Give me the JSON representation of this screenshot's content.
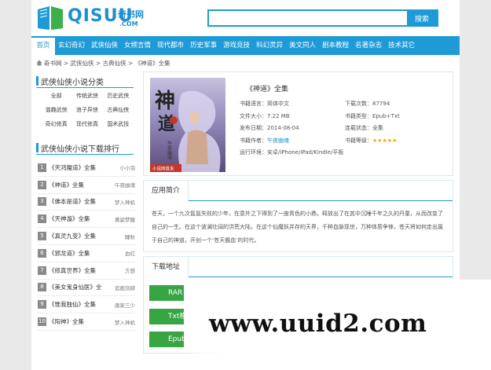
{
  "header": {
    "brand": "QISUU",
    "brand_cn": "奇书网",
    "brand_com": ".COM",
    "search_placeholder": "",
    "search_button": "搜索"
  },
  "nav": [
    "首页",
    "玄幻奇幻",
    "武侠仙侠",
    "女频言情",
    "现代都市",
    "历史军事",
    "游戏竞技",
    "科幻灵异",
    "美文同人",
    "剧本教程",
    "名著杂志",
    "技术其它"
  ],
  "breadcrumb": "奇书网 > 武侠仙侠 > 古典仙侠 > 《神道》全集",
  "sidebar": {
    "categories_title": "武侠仙侠小说分类",
    "categories": [
      "全部",
      "传统武侠",
      "历史武侠",
      "谐趣武侠",
      "浪子异侠",
      "古典仙侠",
      "奇幻修真",
      "现代修真",
      "国术武技"
    ],
    "ranking_title": "武侠仙侠小说下载排行",
    "ranking": [
      {
        "num": "1",
        "title": "《天鸿魔道》全集",
        "author": "小小羽"
      },
      {
        "num": "2",
        "title": "《神道》全集",
        "author": "午夜幽魂"
      },
      {
        "num": "3",
        "title": "《佛本是道》全集",
        "author": "梦入神机"
      },
      {
        "num": "4",
        "title": "《天神漩》全集",
        "author": "黄粱梦醒"
      },
      {
        "num": "5",
        "title": "《真灵九变》全集",
        "author": "睡秋"
      },
      {
        "num": "6",
        "title": "《邪龙道》全集",
        "author": "血红"
      },
      {
        "num": "7",
        "title": "《修真世界》全集",
        "author": "方想"
      },
      {
        "num": "8",
        "title": "《美女鬼身仙医》全",
        "author": "追画剑肆"
      },
      {
        "num": "9",
        "title": "《惟我独仙》全集",
        "author": "唐家三少"
      },
      {
        "num": "10",
        "title": "《阳神》全集",
        "author": "梦入神机"
      }
    ]
  },
  "book": {
    "title": "《神道》全集",
    "language": "书籍语言：简体中文",
    "downloads": "下载次数：87794",
    "size": "文件大小：7.22 MB",
    "type": "书籍类型：Epub+Txt",
    "date": "发布日期：2014-08-04",
    "status": "连载状态：全集",
    "author_label": "书籍作者：",
    "author": "午夜幽魂",
    "rating_label": "书籍等级：",
    "rating": 5,
    "stars": "★★★★★",
    "env": "运行环境：安卓/iPhone/iPad/Kindle/平板",
    "cover_title": "神道",
    "cover_author": "午夜幽魂",
    "cover_badge": "小说网首发"
  },
  "intro": {
    "heading": "应用简介",
    "text": "苍天，一个九次氤氲失败的少年，在意外之下得到了一座青色的小鼎，释放出了在其中沉睡千年之久的丹童，从而改变了自己的一生。在这个波澜壮阔的洪荒大陆，在这个仙魔妖并存的天界，千种血脉现世，万种体质争锋，苍天将如何走出属于自己的神道，开创一个‘苍天霸血’的时代。"
  },
  "download": {
    "heading": "下载地址",
    "buttons": [
      "RAR",
      "Txt格式",
      "Epub格式"
    ]
  },
  "watermark": "www.uuid2.com",
  "colors": {
    "accent": "#1e9bd6",
    "download": "#37a642",
    "star": "#f4a21a"
  }
}
